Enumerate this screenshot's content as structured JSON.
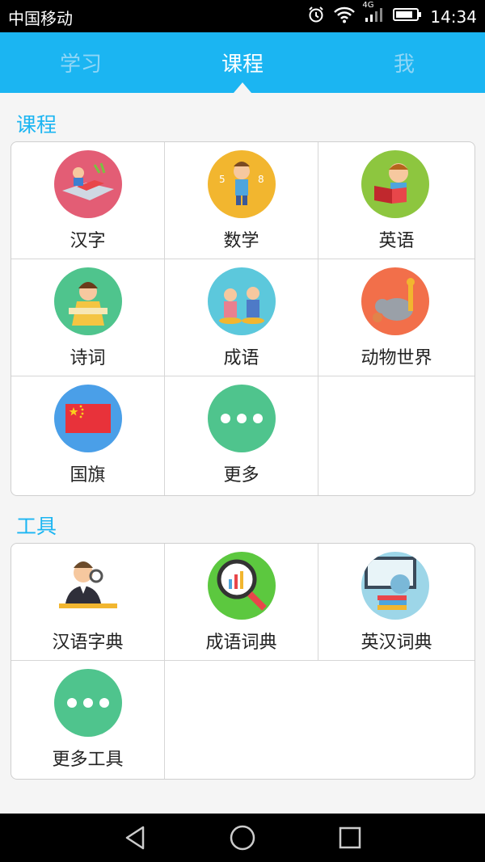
{
  "status": {
    "carrier": "中国移动",
    "network": "4G",
    "time": "14:34"
  },
  "tabs": [
    {
      "label": "学习"
    },
    {
      "label": "课程"
    },
    {
      "label": "我"
    }
  ],
  "courses": {
    "title": "课程",
    "items": [
      {
        "label": "汉字",
        "icon": "hanzi-icon",
        "color": "#e35d75"
      },
      {
        "label": "数学",
        "icon": "math-icon",
        "color": "#f2b62f"
      },
      {
        "label": "英语",
        "icon": "english-icon",
        "color": "#8dc63f"
      },
      {
        "label": "诗词",
        "icon": "poetry-icon",
        "color": "#4fc48d"
      },
      {
        "label": "成语",
        "icon": "idiom-icon",
        "color": "#5cc8dc"
      },
      {
        "label": "动物世界",
        "icon": "animal-world-icon",
        "color": "#f26f4a"
      },
      {
        "label": "国旗",
        "icon": "flag-icon",
        "color": "#4a9fe8"
      },
      {
        "label": "更多",
        "icon": "more-icon",
        "color": "#4fc48d"
      }
    ]
  },
  "tools": {
    "title": "工具",
    "items": [
      {
        "label": "汉语字典",
        "icon": "chinese-dictionary-icon",
        "color": "#ffffff"
      },
      {
        "label": "成语词典",
        "icon": "idiom-dictionary-icon",
        "color": "#5cc83f"
      },
      {
        "label": "英汉词典",
        "icon": "english-chinese-dictionary-icon",
        "color": "#9dd6e8"
      },
      {
        "label": "更多工具",
        "icon": "more-tools-icon",
        "color": "#4fc48d"
      }
    ]
  }
}
